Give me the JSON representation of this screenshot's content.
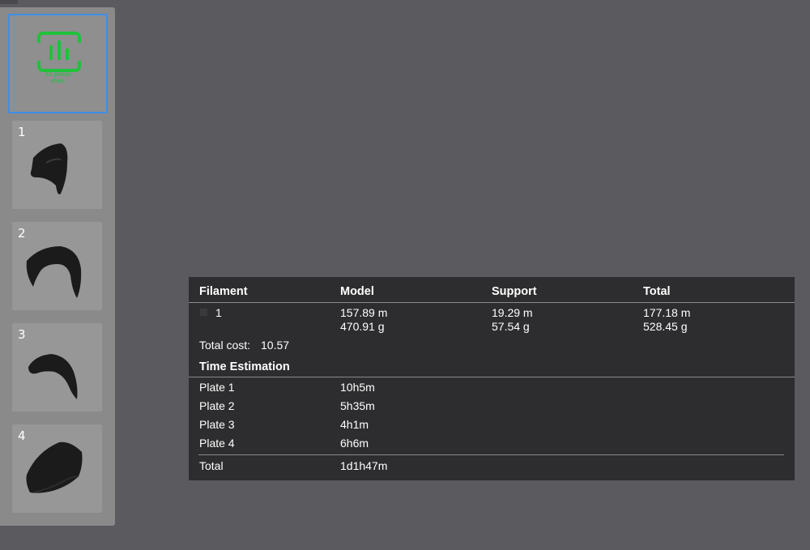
{
  "plates_sidebar": {
    "all_plates_label_line1": "All plates",
    "all_plates_label_line2": "stats",
    "plates": [
      {
        "number": "1"
      },
      {
        "number": "2"
      },
      {
        "number": "3"
      },
      {
        "number": "4"
      }
    ]
  },
  "stats": {
    "headers": {
      "filament": "Filament",
      "model": "Model",
      "support": "Support",
      "total": "Total"
    },
    "filaments": [
      {
        "id": "1",
        "model_length": "157.89 m",
        "model_weight": "470.91 g",
        "support_length": "19.29 m",
        "support_weight": "57.54 g",
        "total_length": "177.18 m",
        "total_weight": "528.45 g"
      }
    ],
    "total_cost_label": "Total cost:",
    "total_cost_value": "10.57",
    "time_estimation_title": "Time Estimation",
    "time_rows": [
      {
        "label": "Plate 1",
        "time": "10h5m"
      },
      {
        "label": "Plate 2",
        "time": "5h35m"
      },
      {
        "label": "Plate 3",
        "time": "4h1m"
      },
      {
        "label": "Plate 4",
        "time": "6h6m"
      }
    ],
    "time_total_label": "Total",
    "time_total_value": "1d1h47m"
  }
}
